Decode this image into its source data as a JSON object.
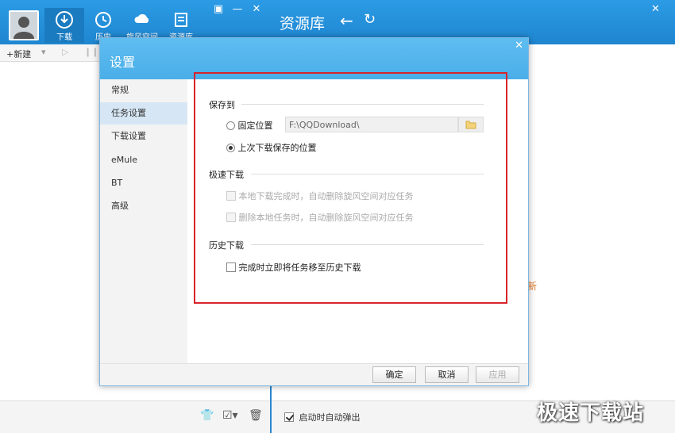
{
  "nav": {
    "items": [
      {
        "label": "下载",
        "icon": "download-icon",
        "active": true
      },
      {
        "label": "历史",
        "icon": "history-icon"
      },
      {
        "label": "旋风空间",
        "icon": "cloud-space-icon"
      },
      {
        "label": "资源库",
        "icon": "library-icon"
      }
    ]
  },
  "toolbar": {
    "new_label": "+新建"
  },
  "right_panel": {
    "title": "资源库"
  },
  "right_bottom": {
    "autostart_label": "启动时自动弹出",
    "autostart_checked": true
  },
  "dialog": {
    "title": "设置",
    "sidebar": [
      {
        "label": "常规"
      },
      {
        "label": "任务设置",
        "active": true
      },
      {
        "label": "下载设置"
      },
      {
        "label": "eMule"
      },
      {
        "label": "BT"
      },
      {
        "label": "高级"
      }
    ],
    "save_to": {
      "section": "保存到",
      "fixed_label": "固定位置",
      "path_value": "F:\\QQDownload\\",
      "last_label": "上次下载保存的位置",
      "selected": "last"
    },
    "speed": {
      "section": "极速下载",
      "option1": "本地下载完成时，自动删除旋风空间对应任务",
      "option2": "删除本地任务时，自动删除旋风空间对应任务"
    },
    "history": {
      "section": "历史下载",
      "option1": "完成时立即将任务移至历史下载"
    },
    "buttons": {
      "ok": "确定",
      "cancel": "取消",
      "apply": "应用"
    }
  },
  "watermark": "极速下载站",
  "colors": {
    "brand_blue": "#2c9be5",
    "highlight_red": "#d9232b"
  }
}
